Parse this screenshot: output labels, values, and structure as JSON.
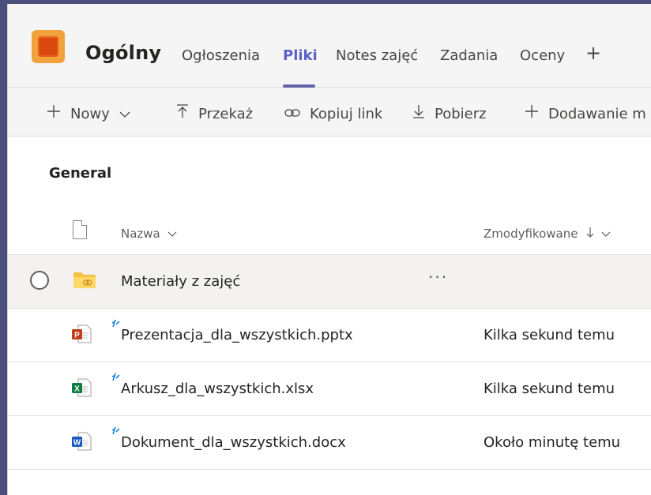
{
  "header": {
    "team_name": "Ogólny",
    "tabs": [
      {
        "label": "Ogłoszenia"
      },
      {
        "label": "Pliki"
      },
      {
        "label": "Notes zajęć"
      },
      {
        "label": "Zadania"
      },
      {
        "label": "Oceny"
      }
    ],
    "active_tab": "Pliki",
    "add_tab_label": "+"
  },
  "toolbar": {
    "new_label": "Nowy",
    "upload_label": "Przekaż",
    "copy_link_label": "Kopiuj link",
    "download_label": "Pobierz",
    "add_label": "Dodawanie m"
  },
  "main": {
    "folder_title": "General",
    "columns": {
      "name": "Nazwa",
      "modified": "Zmodyfikowane"
    },
    "rows": [
      {
        "name": "Materiały z zajęć",
        "modified": "",
        "type": "folder",
        "more": "···"
      },
      {
        "name": "Prezentacja_dla_wszystkich.pptx",
        "modified": "Kilka sekund temu",
        "type": "pptx"
      },
      {
        "name": "Arkusz_dla_wszystkich.xlsx",
        "modified": "Kilka sekund temu",
        "type": "xlsx"
      },
      {
        "name": "Dokument_dla_wszystkich.docx",
        "modified": "Około minutę temu",
        "type": "docx"
      }
    ]
  },
  "colors": {
    "accent": "#6264a7",
    "frame": "#4a4f7c",
    "ppt": "#c43e1c",
    "xls": "#107c41",
    "doc": "#185abd",
    "new_mark": "#0078d4"
  },
  "icons": {
    "team_logo": "team-logo-icon",
    "new": "plus-icon",
    "upload": "upload-icon",
    "copy_link": "link-icon",
    "download": "download-icon",
    "add": "plus-icon"
  }
}
